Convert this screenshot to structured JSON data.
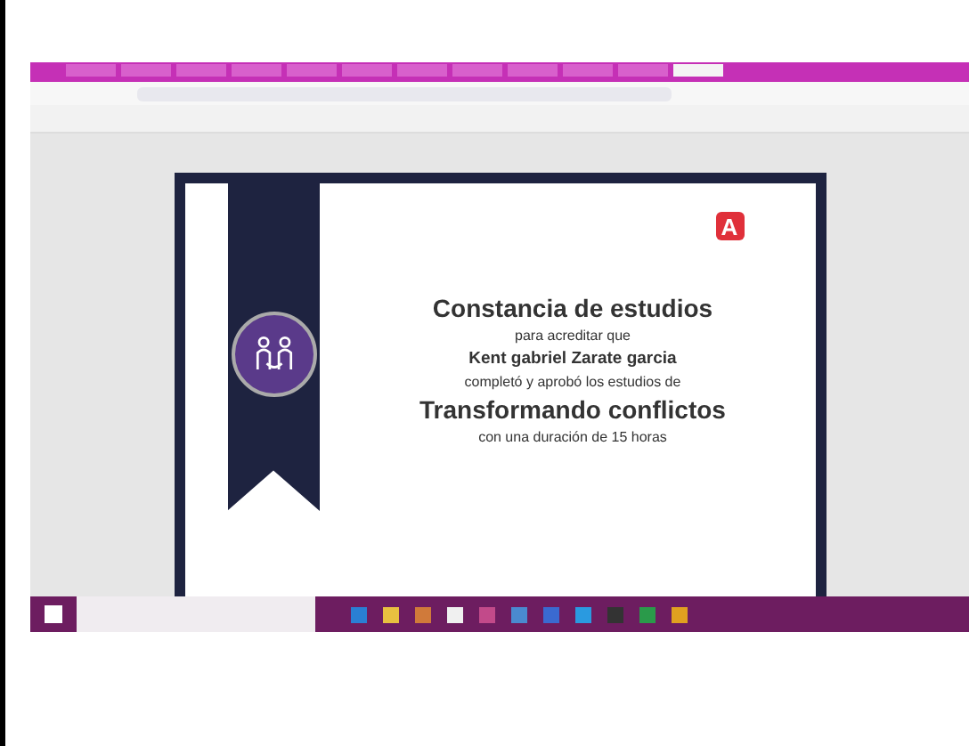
{
  "tabs": [
    {
      "selected": false
    },
    {
      "selected": false
    },
    {
      "selected": false
    },
    {
      "selected": false
    },
    {
      "selected": false
    },
    {
      "selected": false
    },
    {
      "selected": false
    },
    {
      "selected": false
    },
    {
      "selected": false
    },
    {
      "selected": false
    },
    {
      "selected": false
    },
    {
      "selected": true
    }
  ],
  "certificate": {
    "title": "Constancia de estudios",
    "line_1": "para acreditar que",
    "recipient": "Kent gabriel Zarate garcia",
    "line_2": "completó y aprobó los estudios de",
    "course": "Transformando conflictos",
    "duration": "con una duración de 15 horas",
    "logo_letter": "A"
  }
}
